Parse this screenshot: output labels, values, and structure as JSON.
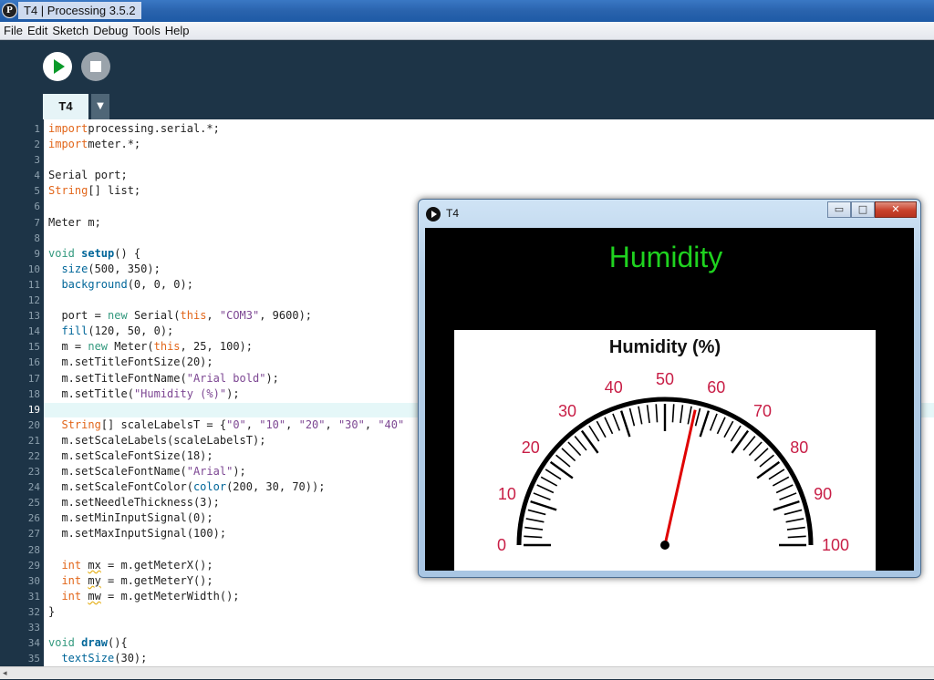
{
  "window": {
    "title": "T4 | Processing 3.5.2"
  },
  "menu": [
    "File",
    "Edit",
    "Sketch",
    "Debug",
    "Tools",
    "Help"
  ],
  "tabs": [
    {
      "label": "T4"
    }
  ],
  "tab_menu_glyph": "▼",
  "editor": {
    "current_line": 19,
    "lines": [
      [
        [
          "kw",
          "import"
        ],
        [
          "",
          "processing.serial.*;"
        ]
      ],
      [
        [
          "kw",
          "import"
        ],
        [
          "",
          "meter.*;"
        ]
      ],
      [],
      [
        [
          "",
          "Serial port;"
        ]
      ],
      [
        [
          "kw",
          "String"
        ],
        [
          "",
          "[] list;"
        ]
      ],
      [],
      [
        [
          "",
          "Meter m;"
        ]
      ],
      [],
      [
        [
          "kw2",
          "void "
        ],
        [
          "fn",
          "setup"
        ],
        [
          "",
          "() {"
        ]
      ],
      [
        [
          "",
          ""
        ],
        [
          "fn2",
          "size"
        ],
        [
          "",
          "(500, 350);"
        ]
      ],
      [
        [
          "",
          ""
        ],
        [
          "fn2",
          "background"
        ],
        [
          "",
          "(0, 0, 0);"
        ]
      ],
      [],
      [
        [
          "",
          "port = "
        ],
        [
          "kw2",
          "new "
        ],
        [
          "",
          "Serial("
        ],
        [
          "kw",
          "this"
        ],
        [
          "",
          ", "
        ],
        [
          "str",
          "\"COM3\""
        ],
        [
          "",
          ", 9600);"
        ]
      ],
      [
        [
          "",
          ""
        ],
        [
          "fn2",
          "fill"
        ],
        [
          "",
          "(120, 50, 0);"
        ]
      ],
      [
        [
          "",
          "m = "
        ],
        [
          "kw2",
          "new "
        ],
        [
          "",
          "Meter("
        ],
        [
          "kw",
          "this"
        ],
        [
          "",
          ", 25, 100);"
        ]
      ],
      [
        [
          "",
          "m.setTitleFontSize(20);"
        ]
      ],
      [
        [
          "",
          "m.setTitleFontName("
        ],
        [
          "str",
          "\"Arial bold\""
        ],
        [
          "",
          ");"
        ]
      ],
      [
        [
          "",
          "m.setTitle("
        ],
        [
          "str",
          "\"Humidity (%)\""
        ],
        [
          "",
          ");"
        ]
      ],
      [],
      [
        [
          "kw",
          "String"
        ],
        [
          "",
          "[] scaleLabelsT = {"
        ],
        [
          "str",
          "\"0\""
        ],
        [
          "",
          ", "
        ],
        [
          "str",
          "\"10\""
        ],
        [
          "",
          ", "
        ],
        [
          "str",
          "\"20\""
        ],
        [
          "",
          ", "
        ],
        [
          "str",
          "\"30\""
        ],
        [
          "",
          ", "
        ],
        [
          "str",
          "\"40\""
        ]
      ],
      [
        [
          "",
          "m.setScaleLabels(scaleLabelsT);"
        ]
      ],
      [
        [
          "",
          "m.setScaleFontSize(18);"
        ]
      ],
      [
        [
          "",
          "m.setScaleFontName("
        ],
        [
          "str",
          "\"Arial\""
        ],
        [
          "",
          ");"
        ]
      ],
      [
        [
          "",
          "m.setScaleFontColor("
        ],
        [
          "fn2",
          "color"
        ],
        [
          "",
          "(200, 30, 70));"
        ]
      ],
      [
        [
          "",
          "m.setNeedleThickness(3);"
        ]
      ],
      [
        [
          "",
          "m.setMinInputSignal(0);"
        ]
      ],
      [
        [
          "",
          "m.setMaxInputSignal(100);"
        ]
      ],
      [],
      [
        [
          "kw",
          "int "
        ],
        [
          "squig",
          "mx"
        ],
        [
          "",
          " = m.getMeterX();"
        ]
      ],
      [
        [
          "kw",
          "int "
        ],
        [
          "squig",
          "my"
        ],
        [
          "",
          " = m.getMeterY();"
        ]
      ],
      [
        [
          "kw",
          "int "
        ],
        [
          "squig",
          "mw"
        ],
        [
          "",
          " = m.getMeterWidth();"
        ]
      ],
      [
        [
          "",
          "}"
        ]
      ],
      [],
      [
        [
          "kw2",
          "void "
        ],
        [
          "fn",
          "draw"
        ],
        [
          "",
          "(){"
        ]
      ],
      [
        [
          "",
          ""
        ],
        [
          "fn2",
          "textSize"
        ],
        [
          "",
          "(30);"
        ]
      ]
    ],
    "indented": [
      10,
      11,
      13,
      14,
      15,
      16,
      17,
      18,
      20,
      21,
      22,
      23,
      24,
      25,
      26,
      27,
      29,
      30,
      31,
      35
    ]
  },
  "sketch": {
    "title": "T4",
    "buttons": {
      "minimize": "▭",
      "maximize": "□",
      "close": "✕"
    },
    "heading": "Humidity",
    "heading_color": "#1fd21f",
    "meter": {
      "title": "Humidity (%)",
      "scale_labels": [
        "0",
        "10",
        "20",
        "30",
        "40",
        "50",
        "60",
        "70",
        "80",
        "90",
        "100"
      ],
      "scale_color": "#c81e46",
      "needle_color": "#e00000",
      "value": 57,
      "min": 0,
      "max": 100
    }
  }
}
